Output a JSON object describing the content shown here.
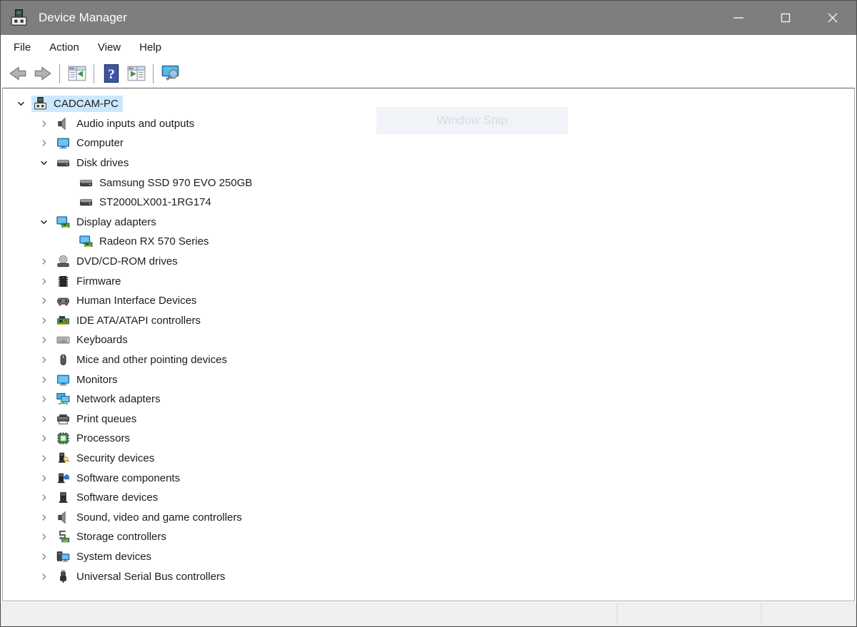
{
  "window": {
    "title": "Device Manager",
    "controls": [
      "minimize-icon",
      "maximize-icon",
      "close-icon"
    ]
  },
  "menu": {
    "items": [
      {
        "label": "File"
      },
      {
        "label": "Action"
      },
      {
        "label": "View"
      },
      {
        "label": "Help"
      }
    ]
  },
  "toolbar": {
    "buttons": [
      {
        "icon": "back"
      },
      {
        "icon": "forward"
      },
      {
        "separator": true
      },
      {
        "icon": "console-tree"
      },
      {
        "separator": true
      },
      {
        "icon": "help"
      },
      {
        "icon": "action-pane"
      },
      {
        "separator": true
      },
      {
        "icon": "scan-hardware"
      }
    ]
  },
  "tree": {
    "items": [
      {
        "label": "CADCAM-PC",
        "level": 0,
        "state": "expanded",
        "icon": "device-manager-root",
        "selected": true
      },
      {
        "label": "Audio inputs and outputs",
        "level": 1,
        "state": "collapsed",
        "icon": "speaker",
        "selected": false
      },
      {
        "label": "Computer",
        "level": 1,
        "state": "collapsed",
        "icon": "monitor",
        "selected": false
      },
      {
        "label": "Disk drives",
        "level": 1,
        "state": "expanded",
        "icon": "disk",
        "selected": false
      },
      {
        "label": "Samsung SSD 970 EVO 250GB",
        "level": 2,
        "state": "leaf",
        "icon": "disk",
        "selected": false
      },
      {
        "label": "ST2000LX001-1RG174",
        "level": 2,
        "state": "leaf",
        "icon": "disk",
        "selected": false
      },
      {
        "label": "Display adapters",
        "level": 1,
        "state": "expanded",
        "icon": "display-adapter",
        "selected": false
      },
      {
        "label": "Radeon RX 570 Series",
        "level": 2,
        "state": "leaf",
        "icon": "display-adapter",
        "selected": false
      },
      {
        "label": "DVD/CD-ROM drives",
        "level": 1,
        "state": "collapsed",
        "icon": "disc-drive",
        "selected": false
      },
      {
        "label": "Firmware",
        "level": 1,
        "state": "collapsed",
        "icon": "firmware",
        "selected": false
      },
      {
        "label": "Human Interface Devices",
        "level": 1,
        "state": "collapsed",
        "icon": "hid",
        "selected": false
      },
      {
        "label": "IDE ATA/ATAPI controllers",
        "level": 1,
        "state": "collapsed",
        "icon": "ide",
        "selected": false
      },
      {
        "label": "Keyboards",
        "level": 1,
        "state": "collapsed",
        "icon": "keyboard",
        "selected": false
      },
      {
        "label": "Mice and other pointing devices",
        "level": 1,
        "state": "collapsed",
        "icon": "mouse",
        "selected": false
      },
      {
        "label": "Monitors",
        "level": 1,
        "state": "collapsed",
        "icon": "monitor",
        "selected": false
      },
      {
        "label": "Network adapters",
        "level": 1,
        "state": "collapsed",
        "icon": "network",
        "selected": false
      },
      {
        "label": "Print queues",
        "level": 1,
        "state": "collapsed",
        "icon": "printer",
        "selected": false
      },
      {
        "label": "Processors",
        "level": 1,
        "state": "collapsed",
        "icon": "processor",
        "selected": false
      },
      {
        "label": "Security devices",
        "level": 1,
        "state": "collapsed",
        "icon": "security",
        "selected": false
      },
      {
        "label": "Software components",
        "level": 1,
        "state": "collapsed",
        "icon": "software-component",
        "selected": false
      },
      {
        "label": "Software devices",
        "level": 1,
        "state": "collapsed",
        "icon": "software-device",
        "selected": false
      },
      {
        "label": "Sound, video and game controllers",
        "level": 1,
        "state": "collapsed",
        "icon": "speaker",
        "selected": false
      },
      {
        "label": "Storage controllers",
        "level": 1,
        "state": "collapsed",
        "icon": "storage",
        "selected": false
      },
      {
        "label": "System devices",
        "level": 1,
        "state": "collapsed",
        "icon": "system",
        "selected": false
      },
      {
        "label": "Universal Serial Bus controllers",
        "level": 1,
        "state": "collapsed",
        "icon": "usb",
        "selected": false
      }
    ]
  },
  "overlay": {
    "label": "Window Snip"
  },
  "statusbar": {
    "segments": [
      "",
      "",
      ""
    ]
  },
  "colors": {
    "titlebar_bg": "#7e7e7e",
    "titlebar_text": "#ffffff",
    "selection_bg": "#cce8ff",
    "monitor_blue": "#45aee8",
    "card_green": "#49a24f",
    "key_gold": "#d9a93a"
  }
}
